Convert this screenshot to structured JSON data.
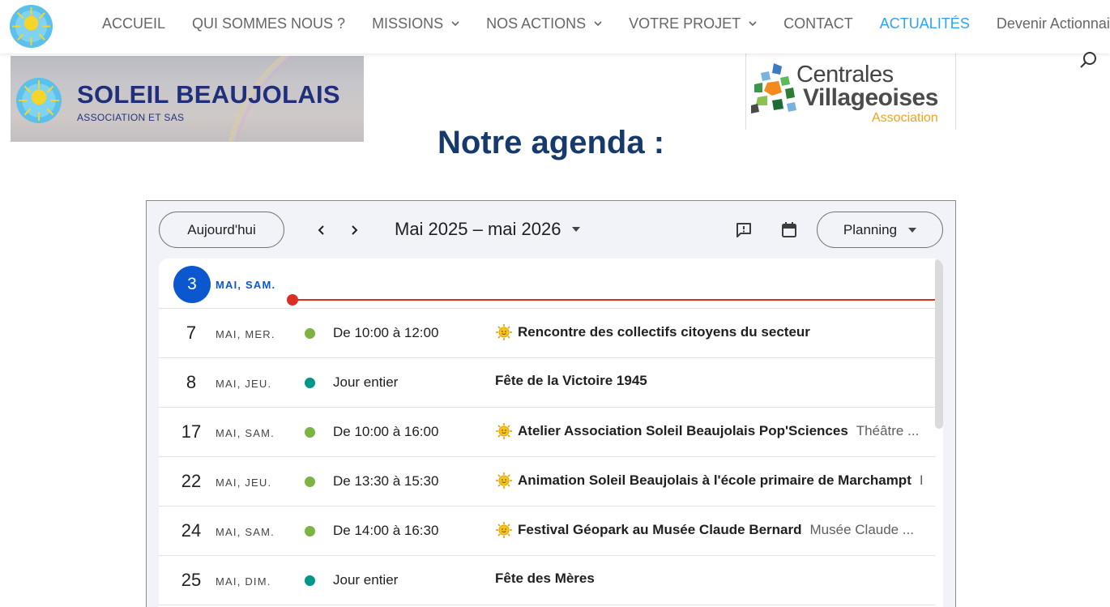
{
  "nav": {
    "items": [
      {
        "label": "ACCUEIL",
        "dropdown": false,
        "active": false
      },
      {
        "label": "QUI SOMMES NOUS ?",
        "dropdown": false,
        "active": false
      },
      {
        "label": "MISSIONS",
        "dropdown": true,
        "active": false
      },
      {
        "label": "NOS ACTIONS",
        "dropdown": true,
        "active": false
      },
      {
        "label": "VOTRE PROJET",
        "dropdown": true,
        "active": false
      },
      {
        "label": "CONTACT",
        "dropdown": false,
        "active": false
      },
      {
        "label": "ACTUALITÉS",
        "dropdown": false,
        "active": true
      },
      {
        "label": "Devenir Actionnaire",
        "dropdown": false,
        "active": false
      }
    ],
    "active_color": "#2ea3f2"
  },
  "banner": {
    "title": "SOLEIL BEAUJOLAIS",
    "subtitle": "ASSOCIATION ET SAS",
    "logo_text": "Soleil Beaujolais"
  },
  "partner_logo": {
    "line1": "Centrales",
    "line2": "Villageoises",
    "line3": "Association"
  },
  "page": {
    "heading": "Notre agenda :"
  },
  "calendar": {
    "today_button": "Aujourd'hui",
    "range_label": "Mai 2025 – mai 2026",
    "view_button": "Planning",
    "icons": {
      "prev": "chevron-left-icon",
      "next": "chevron-right-icon",
      "feedback": "feedback-icon",
      "calendar": "calendar-icon"
    },
    "today": {
      "day": "3",
      "dow": "MAI, SAM."
    },
    "colors": {
      "today": "#0b57d0",
      "now_line": "#d93025",
      "green": "#7cb342",
      "teal": "#009688"
    },
    "events": [
      {
        "day": "7",
        "dow": "MAI, MER.",
        "color": "#7cb342",
        "time": "De 10:00 à 12:00",
        "sun": true,
        "title": "Rencontre des collectifs citoyens du secteur",
        "location": ""
      },
      {
        "day": "8",
        "dow": "MAI, JEU.",
        "color": "#009688",
        "time": "Jour entier",
        "sun": false,
        "title": "Fête de la Victoire 1945",
        "location": ""
      },
      {
        "day": "17",
        "dow": "MAI, SAM.",
        "color": "#7cb342",
        "time": "De 10:00 à 16:00",
        "sun": true,
        "title": "Atelier Association Soleil Beaujolais Pop'Sciences",
        "location": "Théâtre ..."
      },
      {
        "day": "22",
        "dow": "MAI, JEU.",
        "color": "#7cb342",
        "time": "De 13:30 à 15:30",
        "sun": true,
        "title": "Animation Soleil Beaujolais à l'école primaire de Marchampt",
        "location": "I"
      },
      {
        "day": "24",
        "dow": "MAI, SAM.",
        "color": "#7cb342",
        "time": "De 14:00 à 16:30",
        "sun": true,
        "title": "Festival Géopark au Musée Claude Bernard",
        "location": "Musée Claude ..."
      },
      {
        "day": "25",
        "dow": "MAI, DIM.",
        "color": "#009688",
        "time": "Jour entier",
        "sun": false,
        "title": "Fête des Mères",
        "location": ""
      }
    ]
  }
}
